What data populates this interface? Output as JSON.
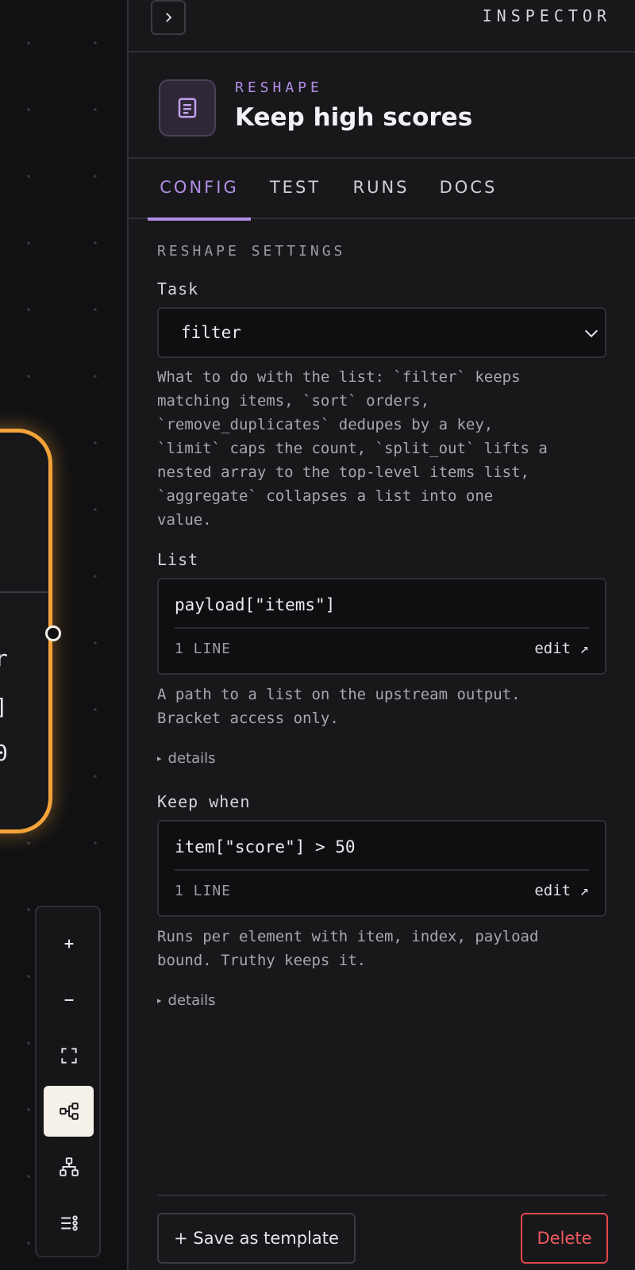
{
  "inspector": {
    "title": "INSPECTOR",
    "collapse_icon": "chevron-right-icon"
  },
  "node": {
    "kind": "RESHAPE",
    "name": "Keep high scores",
    "icon": "document-icon",
    "accent_color": "#b48ee6"
  },
  "tabs": [
    {
      "label": "CONFIG",
      "active": true
    },
    {
      "label": "TEST",
      "active": false
    },
    {
      "label": "RUNS",
      "active": false
    },
    {
      "label": "DOCS",
      "active": false
    }
  ],
  "settings": {
    "section_title": "RESHAPE SETTINGS",
    "task": {
      "label": "Task",
      "value": "filter",
      "help": "What to do with the list: `filter` keeps\nmatching items, `sort` orders,\n`remove_duplicates` dedupes by a key,\n`limit` caps the count, `split_out` lifts a\nnested array to the top-level items list,\n`aggregate` collapses a list into one\nvalue."
    },
    "list": {
      "label": "List",
      "code": "payload[\"items\"]",
      "line_count": "1 LINE",
      "edit_label": "edit ↗",
      "help": "A path to a list on the upstream output.\nBracket access only.",
      "details_label": "details"
    },
    "keep_when": {
      "label": "Keep when",
      "code": "item[\"score\"] > 50",
      "line_count": "1 LINE",
      "edit_label": "edit ↗",
      "help": "Runs per element with item, index, payload\nbound. Truthy keeps it.",
      "details_label": "details"
    }
  },
  "footer": {
    "save_label": "+ Save as template",
    "delete_label": "Delete",
    "delete_color": "#e0474c"
  },
  "canvas": {
    "node_border_color": "#f4a33a",
    "toolbar": [
      {
        "icon": "zoom-in-icon",
        "active": false
      },
      {
        "icon": "zoom-out-icon",
        "active": false
      },
      {
        "icon": "fit-view-icon",
        "active": false
      },
      {
        "icon": "graph-layout-icon",
        "active": true
      },
      {
        "icon": "tree-layout-icon",
        "active": false
      },
      {
        "icon": "list-view-icon",
        "active": false
      }
    ]
  }
}
